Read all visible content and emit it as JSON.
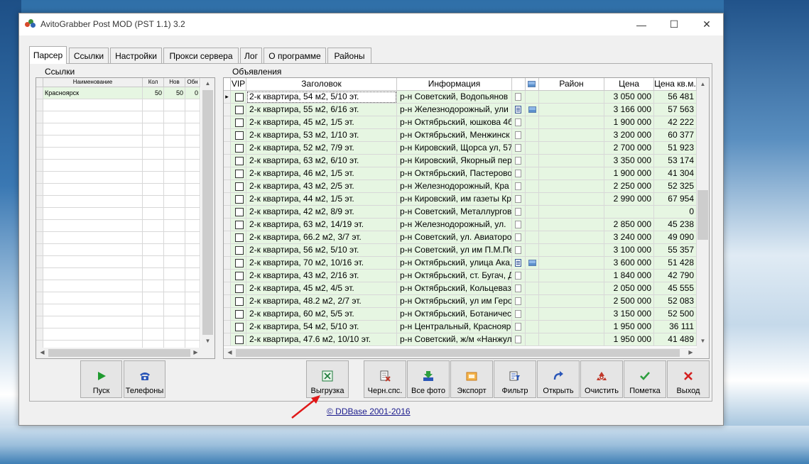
{
  "window": {
    "title": "AvitoGrabber Post MOD (PST 1.1) 3.2",
    "minimize": "—",
    "maximize": "☐",
    "close": "✕"
  },
  "tabs": [
    {
      "label": "Парсер",
      "active": true
    },
    {
      "label": "Ссылки"
    },
    {
      "label": "Настройки"
    },
    {
      "label": "Прокси сервера"
    },
    {
      "label": "Лог"
    },
    {
      "label": "О программе"
    },
    {
      "label": "Районы"
    }
  ],
  "links_panel": {
    "label": "Ссылки",
    "columns": [
      "Наименование",
      "Кол",
      "Нов",
      "Обн"
    ],
    "rows": [
      {
        "name": "Красноярск",
        "count": "50",
        "new": "50",
        "upd": "0"
      }
    ]
  },
  "ads_panel": {
    "label": "Объявления",
    "columns": [
      "VIP",
      "Заголовок",
      "Информация",
      "",
      "",
      "Район",
      "Цена",
      "Цена кв.м."
    ],
    "rows": [
      {
        "title": "2-к квартира, 54 м2, 5/10 эт.",
        "info": "р-н Советский, Водопьянов",
        "doc": false,
        "pic": false,
        "price": "3 050 000",
        "sqm": "56 481"
      },
      {
        "title": "2-к квартира, 55 м2, 6/16 эт.",
        "info": "р-н Железнодорожный, ули",
        "doc": true,
        "pic": true,
        "price": "3 166 000",
        "sqm": "57 563"
      },
      {
        "title": "2-к квартира, 45 м2, 1/5 эт.",
        "info": "р-н Октябрьский, юшкова 4б",
        "doc": false,
        "pic": false,
        "price": "1 900 000",
        "sqm": "42 222"
      },
      {
        "title": "2-к квартира, 53 м2, 1/10 эт.",
        "info": "р-н Октябрьский, Менжинск",
        "doc": false,
        "pic": false,
        "price": "3 200 000",
        "sqm": "60 377"
      },
      {
        "title": "2-к квартира, 52 м2, 7/9 эт.",
        "info": "р-н Кировский, Щорса ул, 57",
        "doc": false,
        "pic": false,
        "price": "2 700 000",
        "sqm": "51 923"
      },
      {
        "title": "2-к квартира, 63 м2, 6/10 эт.",
        "info": "р-н Кировский, Якорный пер",
        "doc": false,
        "pic": false,
        "price": "3 350 000",
        "sqm": "53 174"
      },
      {
        "title": "2-к квартира, 46 м2, 1/5 эт.",
        "info": "р-н Октябрьский, Пастерово",
        "doc": false,
        "pic": false,
        "price": "1 900 000",
        "sqm": "41 304"
      },
      {
        "title": "2-к квартира, 43 м2, 2/5 эт.",
        "info": "р-н Железнодорожный, Кра",
        "doc": false,
        "pic": false,
        "price": "2 250 000",
        "sqm": "52 325"
      },
      {
        "title": "2-к квартира, 44 м2, 1/5 эт.",
        "info": "р-н Кировский, им газеты Кр",
        "doc": false,
        "pic": false,
        "price": "2 990 000",
        "sqm": "67 954"
      },
      {
        "title": "2-к квартира, 42 м2, 8/9 эт.",
        "info": "р-н Советский, Металлургов",
        "doc": false,
        "pic": false,
        "price": "",
        "sqm": "0"
      },
      {
        "title": "2-к квартира, 63 м2, 14/19 эт.",
        "info": "р-н Железнодорожный, ул. ",
        "doc": false,
        "pic": false,
        "price": "2 850 000",
        "sqm": "45 238"
      },
      {
        "title": "2-к квартира, 66.2 м2, 3/7 эт.",
        "info": "р-н Советский, ул. Авиаторо",
        "doc": false,
        "pic": false,
        "price": "3 240 000",
        "sqm": "49 090"
      },
      {
        "title": "2-к квартира, 56 м2, 5/10 эт.",
        "info": "р-н Советский, ул им П.М.Пе",
        "doc": false,
        "pic": false,
        "price": "3 100 000",
        "sqm": "55 357"
      },
      {
        "title": "2-к квартира, 70 м2, 10/16 эт.",
        "info": "р-н Октябрьский, улица Ака,",
        "doc": true,
        "pic": true,
        "price": "3 600 000",
        "sqm": "51 428"
      },
      {
        "title": "2-к квартира, 43 м2, 2/16 эт.",
        "info": "р-н Октябрьский, ст. Бугач, Д",
        "doc": false,
        "pic": false,
        "price": "1 840 000",
        "sqm": "42 790"
      },
      {
        "title": "2-к квартира, 45 м2, 4/5 эт.",
        "info": "р-н Октябрьский, Кольцеваз",
        "doc": false,
        "pic": false,
        "price": "2 050 000",
        "sqm": "45 555"
      },
      {
        "title": "2-к квартира, 48.2 м2, 2/7 эт.",
        "info": "р-н Октябрьский, ул им Геро",
        "doc": false,
        "pic": false,
        "price": "2 500 000",
        "sqm": "52 083"
      },
      {
        "title": "2-к квартира, 60 м2, 5/5 эт.",
        "info": "р-н Октябрьский, Ботаничес",
        "doc": false,
        "pic": false,
        "price": "3 150 000",
        "sqm": "52 500"
      },
      {
        "title": "2-к квартира, 54 м2, 5/10 эт.",
        "info": "р-н Центральный, Красноярс",
        "doc": false,
        "pic": false,
        "price": "1 950 000",
        "sqm": "36 111"
      },
      {
        "title": "2-к квартира, 47.6 м2, 10/10 эт.",
        "info": "р-н Советский, ж/м «Нанжул",
        "doc": false,
        "pic": false,
        "price": "1 950 000",
        "sqm": "41 489"
      }
    ]
  },
  "buttons": {
    "start": {
      "label": "Пуск",
      "icon": "play-icon",
      "color": "#1f9a2f"
    },
    "phones": {
      "label": "Телефоны",
      "icon": "phone-icon",
      "color": "#2a56b8"
    },
    "export_xls": {
      "label": "Выгрузка",
      "icon": "excel-icon",
      "color": "#1d7a3a"
    },
    "blacklist": {
      "label": "Черн.спс.",
      "icon": "blacklist-icon",
      "color": "#c0392b"
    },
    "all_photos": {
      "label": "Все фото",
      "icon": "download-icon",
      "color": "#2e9e3f"
    },
    "export": {
      "label": "Экспорт",
      "icon": "export-icon",
      "color": "#e08a1e"
    },
    "filter": {
      "label": "Фильтр",
      "icon": "filter-icon",
      "color": "#2a56b8"
    },
    "open": {
      "label": "Открыть",
      "icon": "open-icon",
      "color": "#2a56b8"
    },
    "clear": {
      "label": "Очистить",
      "icon": "recycle-icon",
      "color": "#c0392b"
    },
    "mark": {
      "label": "Пометка",
      "icon": "checkmark-icon",
      "color": "#2e9e3f"
    },
    "exit": {
      "label": "Выход",
      "icon": "close-x-icon",
      "color": "#d42020"
    }
  },
  "footer": {
    "link": "© DDBase 2001-2016"
  }
}
